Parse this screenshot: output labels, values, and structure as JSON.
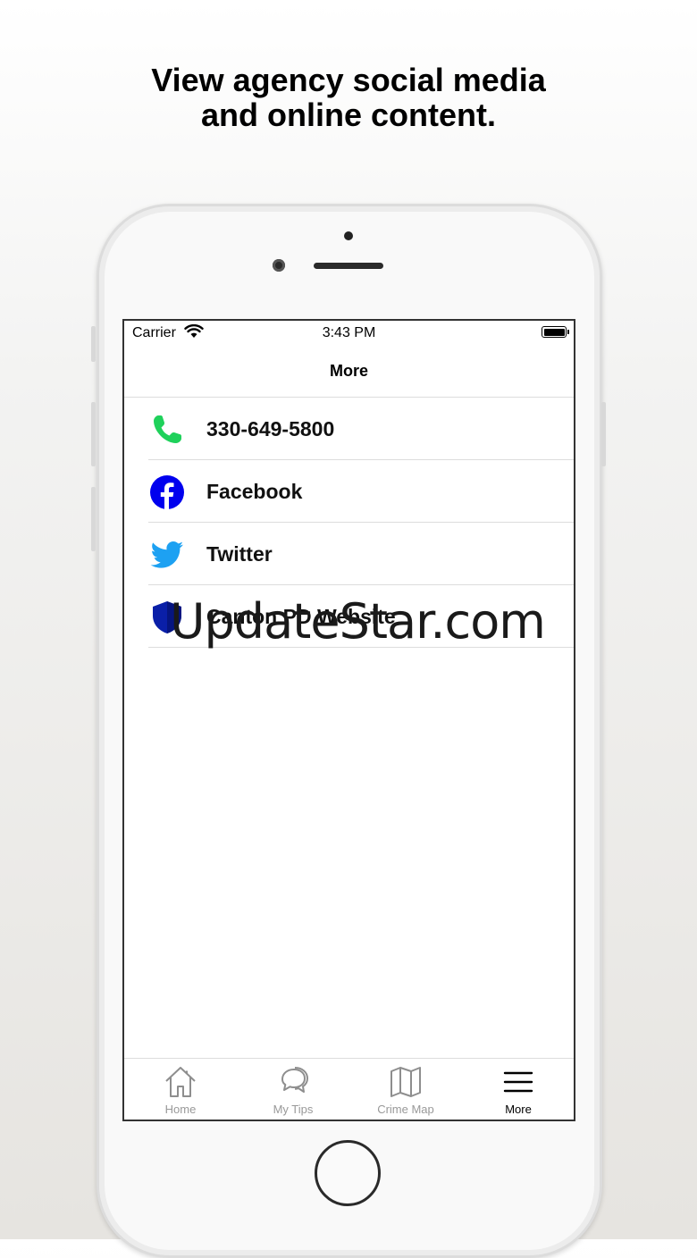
{
  "headline": {
    "line1": "View agency social media",
    "line2": "and online content."
  },
  "status_bar": {
    "carrier": "Carrier",
    "time": "3:43 PM"
  },
  "nav": {
    "title": "More"
  },
  "list_items": [
    {
      "label": "330-649-5800",
      "icon": "phone-icon",
      "color": "#1fd15b"
    },
    {
      "label": "Facebook",
      "icon": "facebook-icon",
      "color": "#0000ee"
    },
    {
      "label": "Twitter",
      "icon": "twitter-icon",
      "color": "#1da1f2"
    },
    {
      "label": "Canton PD Website",
      "icon": "shield-icon",
      "color": "#0a1fa8"
    }
  ],
  "tabs": [
    {
      "label": "Home",
      "icon": "home-icon",
      "active": false
    },
    {
      "label": "My Tips",
      "icon": "chat-bubbles-icon",
      "active": false
    },
    {
      "label": "Crime Map",
      "icon": "map-icon",
      "active": false
    },
    {
      "label": "More",
      "icon": "menu-icon",
      "active": true
    }
  ],
  "watermark": "UpdateStar.com"
}
